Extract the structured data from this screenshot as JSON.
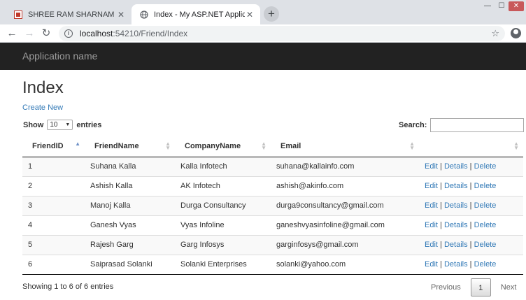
{
  "browser": {
    "tabs": [
      {
        "title": "SHREE RAM SHARNAM - International",
        "active": false
      },
      {
        "title": "Index - My ASP.NET Application",
        "active": true
      }
    ],
    "new_tab": "+",
    "url_host": "localhost",
    "url_rest": ":54210/Friend/Index",
    "back": "←",
    "forward": "→",
    "reload": "↻",
    "star": "☆",
    "win_min": "—",
    "win_max": "☐",
    "win_close": "✕"
  },
  "app": {
    "brand": "Application name",
    "page_title": "Index",
    "create_new": "Create New"
  },
  "length": {
    "show": "Show",
    "value": "10",
    "entries": "entries"
  },
  "search": {
    "label": "Search:"
  },
  "table": {
    "columns": [
      "FriendID",
      "FriendName",
      "CompanyName",
      "Email",
      ""
    ],
    "sorted_column": "FriendID",
    "rows": [
      {
        "id": "1",
        "name": "Suhana Kalla",
        "company": "Kalla Infotech",
        "email": "suhana@kallainfo.com"
      },
      {
        "id": "2",
        "name": "Ashish Kalla",
        "company": "AK Infotech",
        "email": "ashish@akinfo.com"
      },
      {
        "id": "3",
        "name": "Manoj Kalla",
        "company": "Durga Consultancy",
        "email": "durga9consultancy@gmail.com"
      },
      {
        "id": "4",
        "name": "Ganesh Vyas",
        "company": "Vyas Infoline",
        "email": "ganeshvyasinfoline@gmail.com"
      },
      {
        "id": "5",
        "name": "Rajesh Garg",
        "company": "Garg Infosys",
        "email": "garginfosys@gmail.com"
      },
      {
        "id": "6",
        "name": "Saiprasad Solanki",
        "company": "Solanki Enterprises",
        "email": "solanki@yahoo.com"
      }
    ],
    "actions": {
      "edit": "Edit",
      "details": "Details",
      "delete": "Delete",
      "separator": "|"
    }
  },
  "footer": {
    "info": "Showing 1 to 6 of 6 entries",
    "previous": "Previous",
    "page": "1",
    "next": "Next"
  },
  "colors": {
    "navbar": "#222222",
    "link": "#337ab7",
    "chrome": "#dee1e6"
  }
}
